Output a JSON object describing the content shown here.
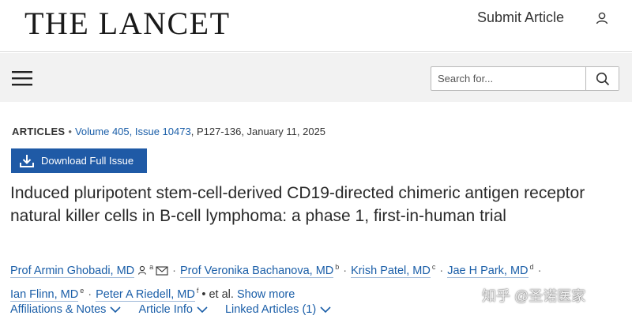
{
  "header": {
    "logo": "THE LANCET",
    "submit_label": "Submit Article",
    "user_icon": "user-icon"
  },
  "nav": {
    "menu_icon": "hamburger-menu-icon",
    "search_placeholder": "Search for...",
    "search_icon": "search-icon"
  },
  "article": {
    "section": "ARTICLES",
    "volume": "Volume 405, Issue 10473",
    "pages_date": "P127-136, January 11, 2025",
    "download_label": "Download Full Issue",
    "title": "Induced pluripotent stem-cell-derived CD19-directed chimeric antigen receptor natural killer cells in B-cell lymphoma: a phase 1, first-in-human trial",
    "authors": [
      {
        "name": "Prof Armin Ghobadi, MD",
        "sup": "a"
      },
      {
        "name": "Prof Veronika Bachanova, MD",
        "sup": "b"
      },
      {
        "name": "Krish Patel, MD",
        "sup": "c"
      },
      {
        "name": "Jae H Park, MD",
        "sup": "d"
      },
      {
        "name": "Ian Flinn, MD",
        "sup": "e"
      },
      {
        "name": "Peter A Riedell, MD",
        "sup": "f"
      }
    ],
    "et_al": "• et al.",
    "show_more": "Show more"
  },
  "tabs": [
    {
      "label": "Affiliations & Notes"
    },
    {
      "label": "Article Info"
    },
    {
      "label": "Linked Articles (1)"
    }
  ],
  "watermark": "知乎 @圣诺医家",
  "colors": {
    "link": "#1a5ea8",
    "button": "#1f5aa6",
    "nav_bg": "#f2f2f2"
  }
}
